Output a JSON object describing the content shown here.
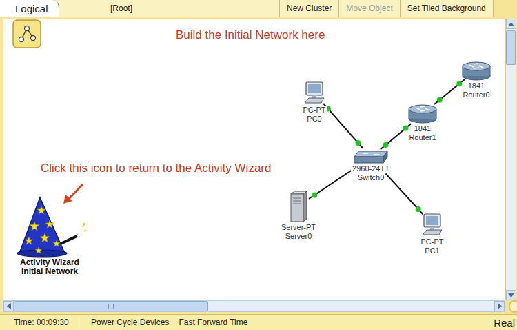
{
  "tabs": [
    {
      "label": "Logical",
      "selected": true
    }
  ],
  "breadcrumb": "[Root]",
  "toolbar": [
    {
      "label": "New Cluster",
      "disabled": false
    },
    {
      "label": "Move Object",
      "disabled": true
    },
    {
      "label": "Set Tiled Background",
      "disabled": false
    }
  ],
  "canvas": {
    "heading": "Build the Initial Network here",
    "hint": "Click this icon to return to the Activity Wizard",
    "wizard": {
      "lines": [
        "Activity Wizard",
        "Initial Network"
      ]
    }
  },
  "devices": [
    {
      "kind": "pc",
      "model": "PC-PT",
      "name": "PC0"
    },
    {
      "kind": "router",
      "model": "1841",
      "name": "Router0"
    },
    {
      "kind": "router",
      "model": "1841",
      "name": "Router1"
    },
    {
      "kind": "switch",
      "model": "2960-24TT",
      "name": "Switch0"
    },
    {
      "kind": "server",
      "model": "Server-PT",
      "name": "Server0"
    },
    {
      "kind": "pc",
      "model": "PC-PT",
      "name": "PC1"
    }
  ],
  "links": [
    {
      "from": "PC0",
      "to": "Switch0",
      "up": true
    },
    {
      "from": "Switch0",
      "to": "Router1",
      "up": true
    },
    {
      "from": "Router1",
      "to": "Router0",
      "up": true
    },
    {
      "from": "Server0",
      "to": "Switch0",
      "up": true
    },
    {
      "from": "Switch0",
      "to": "PC1",
      "up": true
    }
  ],
  "status_bar": {
    "time": "Time: 00:09:30",
    "buttons": [
      "Power Cycle Devices",
      "Fast Forward Time"
    ],
    "mode": "Real"
  }
}
